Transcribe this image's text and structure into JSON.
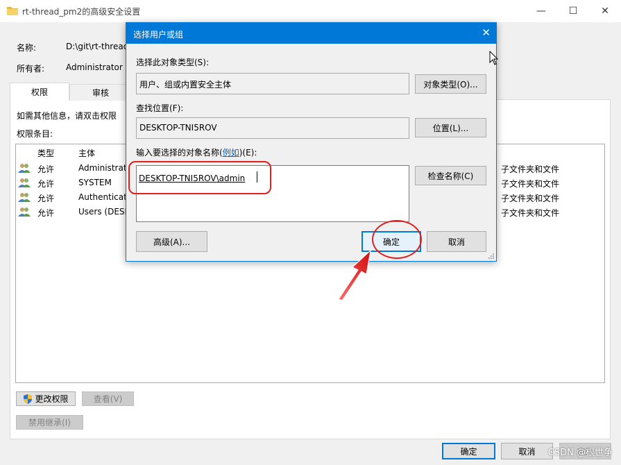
{
  "window": {
    "title": "rt-thread_pm2的高级安全设置",
    "controls": {
      "minimize": "—",
      "maximize": "☐",
      "close": "✕"
    }
  },
  "info": {
    "name_label": "名称:",
    "name_value": "D:\\git\\rt-thread",
    "owner_label": "所有者:",
    "owner_value": "Administrator ("
  },
  "tabs": [
    {
      "label": "权限"
    },
    {
      "label": "审核"
    }
  ],
  "panel": {
    "hint": "如需其他信息，请双击权限",
    "entries_label": "权限条目:",
    "columns": {
      "type": "类型",
      "principal": "主体"
    },
    "rows": [
      {
        "type": "允许",
        "principal": "Administrato",
        "applies": "子文件夹和文件"
      },
      {
        "type": "允许",
        "principal": "SYSTEM",
        "applies": "子文件夹和文件"
      },
      {
        "type": "允许",
        "principal": "Authenticate",
        "applies": "子文件夹和文件"
      },
      {
        "type": "允许",
        "principal": "Users (DESK",
        "applies": "子文件夹和文件"
      }
    ],
    "buttons": {
      "change": "更改权限",
      "view": "查看(V)",
      "disable_inherit": "禁用继承(I)"
    }
  },
  "footer": {
    "ok": "确定",
    "cancel": "取消",
    "apply": "应用"
  },
  "dialog": {
    "title": "选择用户或组",
    "object_type_label": "选择此对象类型(S):",
    "object_type_value": "用户、组或内置安全主体",
    "object_type_button": "对象类型(O)...",
    "location_label": "查找位置(F):",
    "location_value": "DESKTOP-TNI5ROV",
    "location_button": "位置(L)...",
    "names_label_pre": "输入要选择的对象名称(",
    "names_label_link": "例如",
    "names_label_post": ")(E):",
    "names_value": "DESKTOP-TNI5ROV\\admin",
    "check_button": "检查名称(C)",
    "advanced_button": "高级(A)...",
    "ok_button": "确定",
    "cancel_button": "取消"
  },
  "watermark": "CSDN @根世争",
  "colors": {
    "accent": "#0078d7",
    "annotation": "#e0201e"
  }
}
